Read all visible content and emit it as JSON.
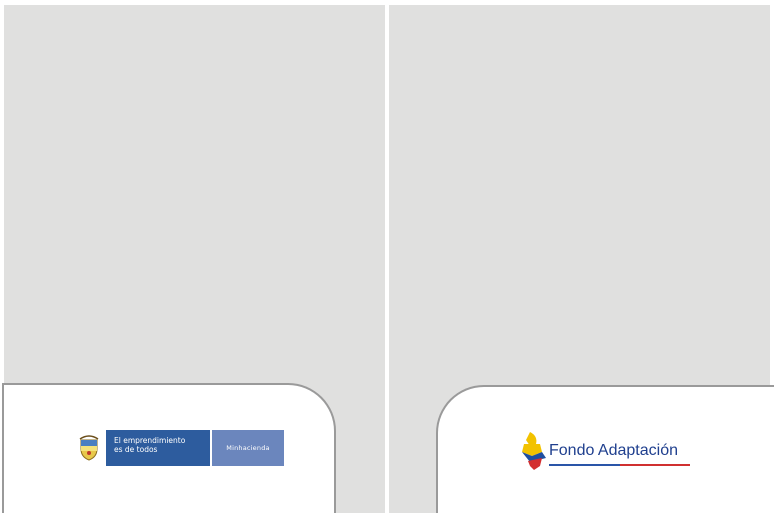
{
  "left_logo": {
    "line1": "El emprendimiento",
    "line2": "es de todos",
    "ministry": "Minhacienda",
    "crest_icon": "colombia-coat-of-arms-icon"
  },
  "right_logo": {
    "name": "Fondo Adaptación",
    "mark_icon": "colombia-map-mark-icon"
  },
  "colors": {
    "panel": "#e0e0df",
    "gov_blue": "#2d5c9e",
    "fondo_blue": "#1f3f8e"
  }
}
